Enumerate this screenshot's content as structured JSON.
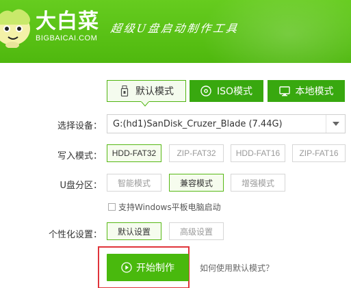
{
  "brand": {
    "name": "大白菜",
    "site": "BIGBAICAI.COM",
    "slogan": "超级U盘启动制作工具"
  },
  "tabs": [
    {
      "label": "默认模式",
      "icon": "usb-drive-icon",
      "selected": true
    },
    {
      "label": "ISO模式",
      "icon": "disc-icon",
      "selected": false
    },
    {
      "label": "本地模式",
      "icon": "monitor-icon",
      "selected": false
    }
  ],
  "device": {
    "label": "选择设备：",
    "value": "G:(hd1)SanDisk_Cruzer_Blade (7.44G)"
  },
  "write_mode": {
    "label": "写入模式：",
    "options": [
      "HDD-FAT32",
      "ZIP-FAT32",
      "HDD-FAT16",
      "ZIP-FAT16"
    ],
    "selected": "HDD-FAT32"
  },
  "partition": {
    "label": "U盘分区：",
    "options": [
      "智能模式",
      "兼容模式",
      "增强模式"
    ],
    "selected": "兼容模式"
  },
  "windows_tablet": {
    "label": "支持Windows平板电脑启动",
    "checked": false
  },
  "personalize": {
    "label": "个性化设置：",
    "options": [
      "默认设置",
      "高级设置"
    ],
    "selected": "默认设置"
  },
  "start": {
    "label": "开始制作"
  },
  "help": {
    "label": "如何使用默认模式？"
  },
  "colors": {
    "header": "#5cc318",
    "tab_active_bg": "#38a80f",
    "accent": "#49b90d",
    "highlight_frame": "#e0343a"
  }
}
